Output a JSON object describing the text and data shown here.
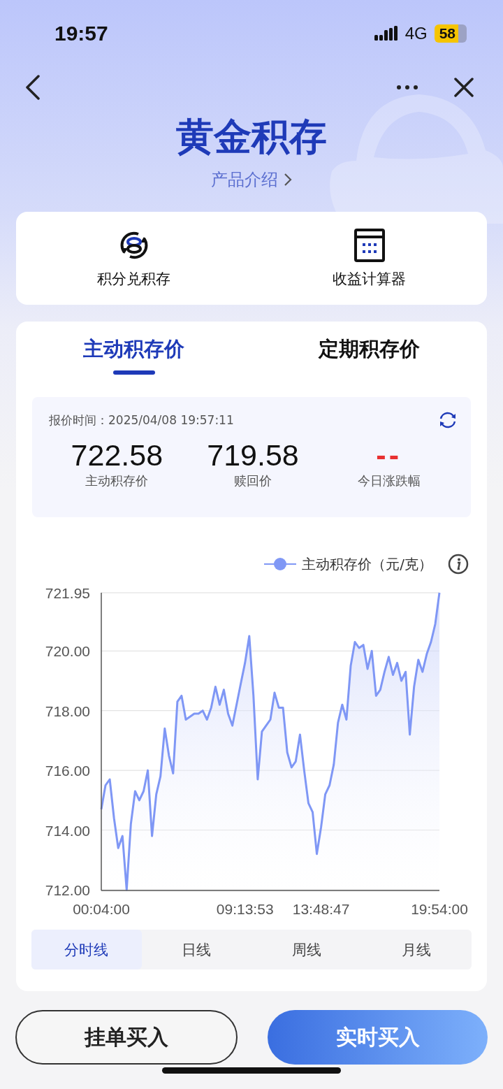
{
  "status_bar": {
    "time": "19:57",
    "network": "4G",
    "battery": "58"
  },
  "header": {
    "title": "黄金积存",
    "intro_link": "产品介绍"
  },
  "shortcuts": [
    {
      "label": "积分兑积存",
      "kind": "exchange"
    },
    {
      "label": "收益计算器",
      "kind": "calculator"
    }
  ],
  "price_tabs": [
    {
      "label": "主动积存价",
      "selected": true
    },
    {
      "label": "定期积存价",
      "selected": false
    }
  ],
  "quote": {
    "time_label": "报价时间：",
    "time": "2025/04/08 19:57:11",
    "items": [
      {
        "value": "722.58",
        "label": "主动积存价",
        "kind": "number"
      },
      {
        "value": "719.58",
        "label": "赎回价",
        "kind": "number"
      },
      {
        "value": "--",
        "label": "今日涨跌幅",
        "kind": "change"
      }
    ]
  },
  "chart": {
    "chart_data": {
      "type": "area",
      "categories": [
        "00:04:00",
        null,
        null,
        null,
        null,
        null,
        null,
        null,
        null,
        null,
        null,
        null,
        null,
        null,
        null,
        null,
        null,
        null,
        null,
        null,
        null,
        null,
        null,
        null,
        null,
        null,
        null,
        null,
        null,
        null,
        null,
        null,
        null,
        null,
        "09:13:53",
        null,
        null,
        null,
        null,
        null,
        null,
        null,
        null,
        null,
        null,
        null,
        null,
        null,
        null,
        null,
        null,
        null,
        "13:48:47",
        null,
        null,
        null,
        null,
        null,
        null,
        null,
        null,
        null,
        null,
        null,
        null,
        null,
        null,
        null,
        null,
        null,
        null,
        null,
        null,
        null,
        null,
        null,
        null,
        null,
        null,
        null,
        "19:54:00"
      ],
      "series": [
        {
          "name": "主动积存价（元/克）",
          "color": "#7f97f5",
          "values": [
            714.7,
            715.5,
            715.7,
            714.4,
            713.4,
            713.8,
            712.0,
            714.2,
            715.3,
            715.0,
            715.3,
            716.0,
            713.8,
            715.2,
            715.8,
            717.4,
            716.5,
            715.9,
            718.3,
            718.5,
            717.7,
            717.8,
            717.9,
            717.9,
            718.0,
            717.7,
            718.1,
            718.8,
            718.2,
            718.7,
            717.9,
            717.5,
            718.2,
            718.9,
            719.6,
            720.5,
            718.5,
            715.7,
            717.3,
            717.5,
            717.7,
            718.6,
            718.1,
            718.1,
            716.6,
            716.1,
            716.3,
            717.2,
            716.0,
            714.9,
            714.6,
            713.2,
            714.1,
            715.2,
            715.5,
            716.2,
            717.6,
            718.2,
            717.7,
            719.5,
            720.3,
            720.1,
            720.2,
            719.4,
            720.0,
            718.5,
            718.7,
            719.3,
            719.8,
            719.2,
            719.6,
            719.0,
            719.3,
            717.2,
            718.8,
            719.7,
            719.3,
            719.9,
            720.3,
            720.9,
            721.95
          ]
        }
      ],
      "ylim": [
        712,
        721.95
      ],
      "grid": true,
      "yticks": [
        {
          "value": 712,
          "label": "712.00"
        },
        {
          "value": 714,
          "label": "714.00"
        },
        {
          "value": 716,
          "label": "716.00"
        },
        {
          "value": 718,
          "label": "718.00"
        },
        {
          "value": 720,
          "label": "720.00"
        },
        {
          "value": 721.95,
          "label": "721.95"
        }
      ]
    }
  },
  "period_tabs": [
    {
      "label": "分时线",
      "selected": true
    },
    {
      "label": "日线",
      "selected": false
    },
    {
      "label": "周线",
      "selected": false
    },
    {
      "label": "月线",
      "selected": false
    }
  ],
  "actions": [
    {
      "label": "挂单买入",
      "kind": "outline"
    },
    {
      "label": "实时买入",
      "kind": "primary"
    }
  ]
}
